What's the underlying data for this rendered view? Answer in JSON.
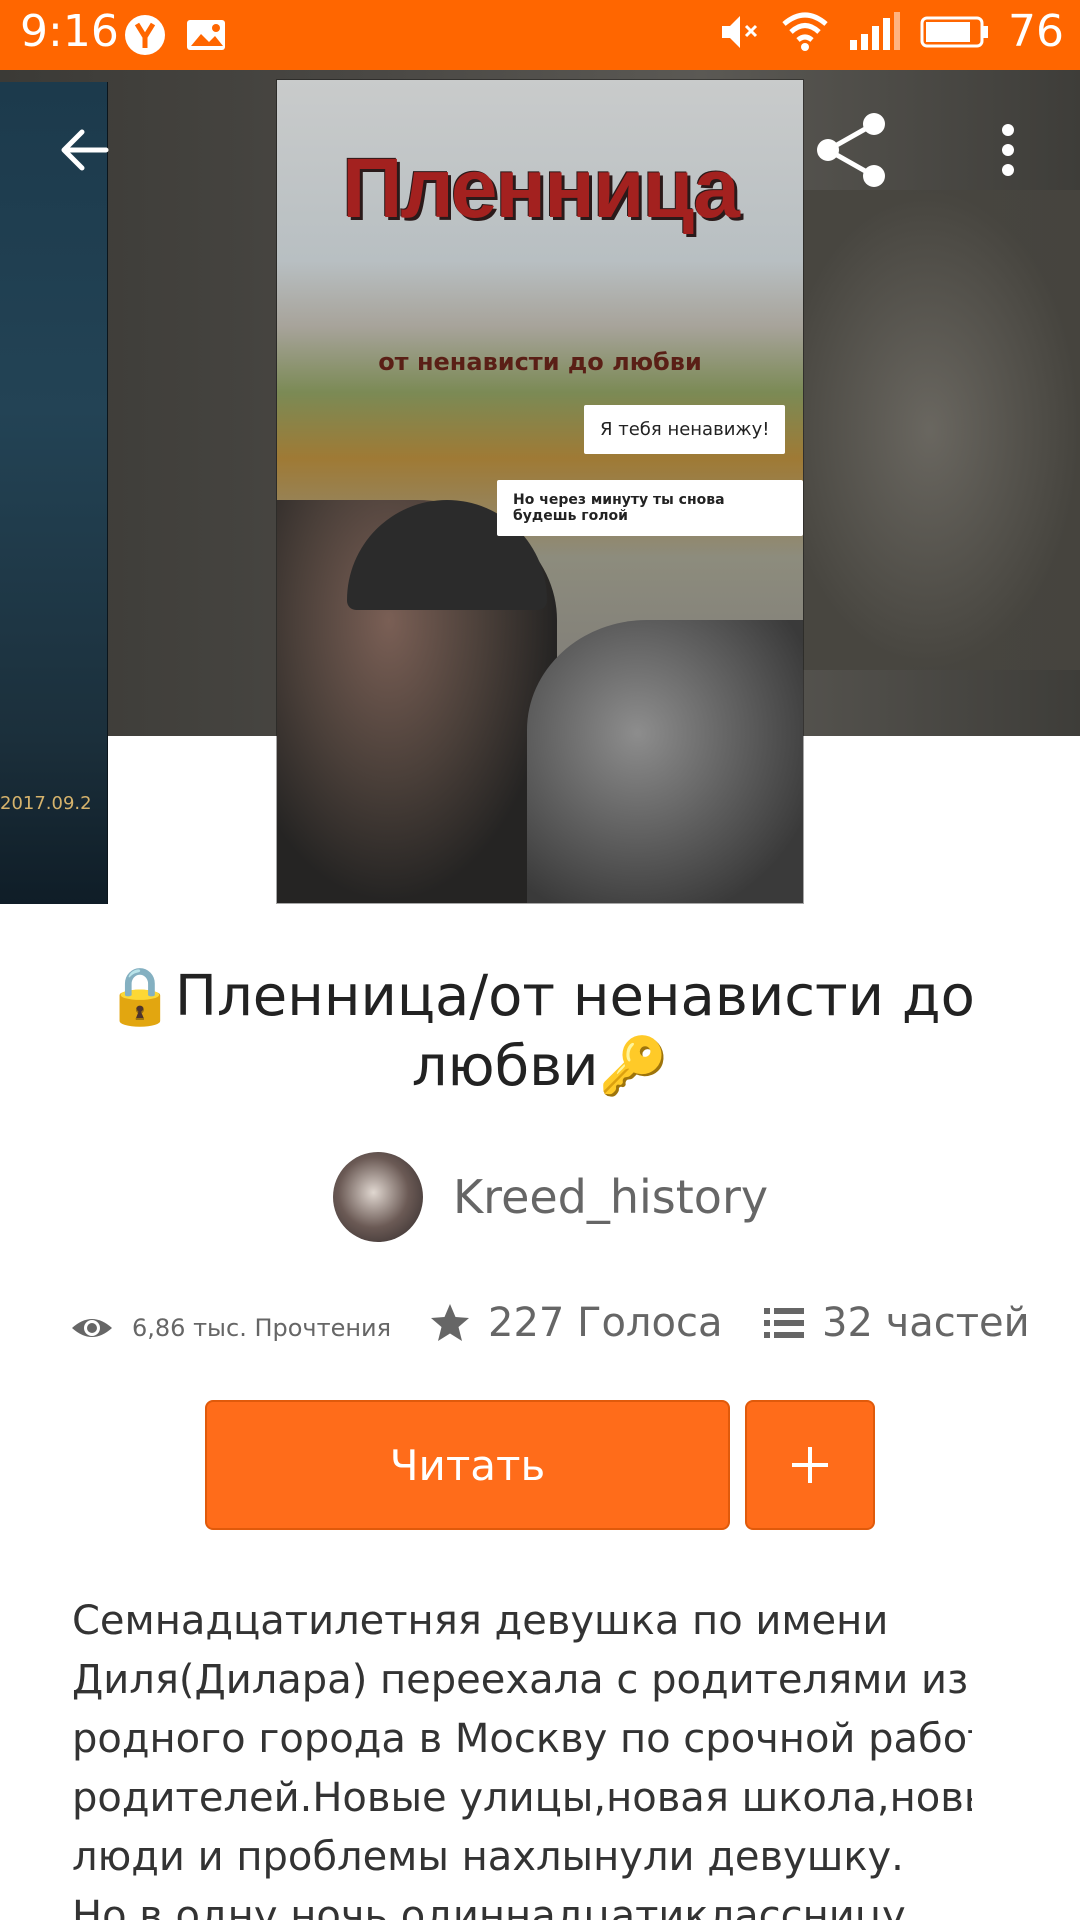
{
  "status_bar": {
    "time": "9:16",
    "battery_level": "76",
    "background_color": "#ff6600",
    "icons": [
      "yandex-icon",
      "image-notification-icon",
      "mute-icon",
      "wifi-icon",
      "signal-icon",
      "battery-icon"
    ]
  },
  "toolbar": {
    "back_icon": "arrow-left-icon",
    "share_icon": "share-icon",
    "menu_icon": "more-vert-icon"
  },
  "prev_cover": {
    "date_text": "2017.09.2"
  },
  "cover": {
    "title": "Пленница",
    "subtitle": "от ненависти до любви",
    "bubble_1": "Я тебя ненавижу!",
    "bubble_2": "Но через минуту ты снова будешь голой"
  },
  "book": {
    "title_line_1": "🔒Пленница/от ненависти до",
    "title_line_2": "любви🔑"
  },
  "author": {
    "name": "Kreed_history"
  },
  "stats": {
    "reads": "6,86 тыс. Прочтения",
    "votes": "227 Голоса",
    "parts": "32 частей"
  },
  "actions": {
    "read_label": "Читать",
    "add_label": "+",
    "accent_color": "#ff6c1a"
  },
  "description": {
    "lines": [
      "Семнадцатилетняя девушка по имени",
      "Диля(Дилара) переехала с родителями из",
      "родного города в Москву по срочной работе",
      "родителей.Новые улицы,новая школа,новые",
      "люди и проблемы нахлынули девушку.",
      "Но в одну ночь одиннадцатиклассницу"
    ]
  }
}
